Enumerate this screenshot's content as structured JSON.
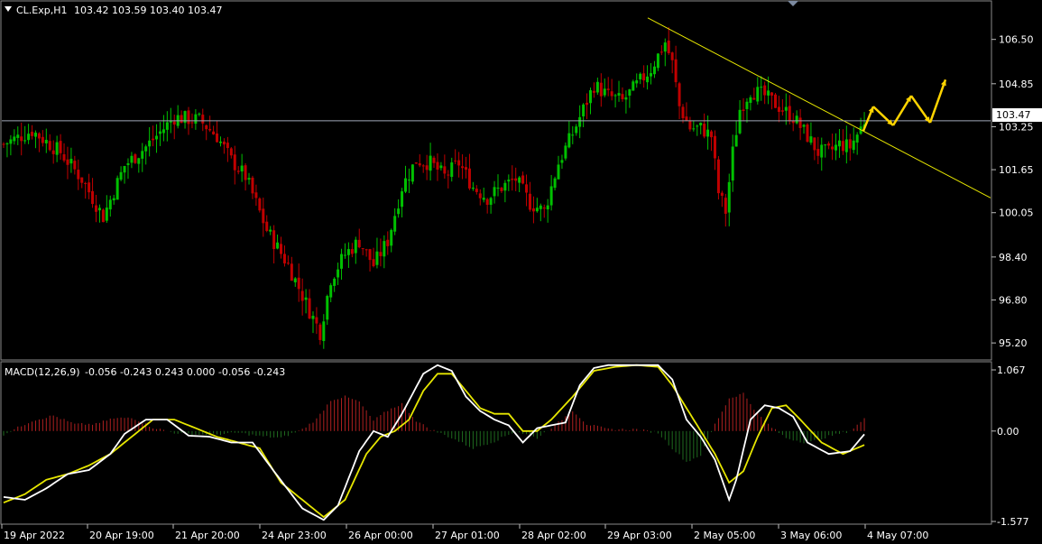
{
  "symbol": "CL.Exp,H1",
  "ohlc": "103.42 103.59 103.40 103.47",
  "macd_label": "MACD(12,26,9)",
  "macd_values": "-0.056 -0.243 0.243 0.000 -0.056 -0.243",
  "current_price": "103.47",
  "colors": {
    "background": "#000000",
    "bull": "#00c000",
    "bear": "#c00000",
    "hist_pos": "#b02020",
    "hist_neg": "#1f6b1f",
    "macd_line": "#ffffff",
    "signal_line": "#e6e600",
    "trendline": "#e6e600",
    "arrows": "#ffd400",
    "price_line": "#9fa8b8",
    "grid_text": "#ffffff"
  },
  "chart_data": [
    {
      "type": "candlestick",
      "title": "CL.Exp,H1",
      "y_ticks": [
        "106.50",
        "104.85",
        "103.25",
        "101.65",
        "100.05",
        "98.40",
        "96.80",
        "95.20"
      ],
      "ylim": [
        94.6,
        107.9
      ],
      "x_ticks": [
        "19 Apr 2022",
        "20 Apr 19:00",
        "21 Apr 20:00",
        "24 Apr 23:00",
        "26 Apr 00:00",
        "27 Apr 01:00",
        "28 Apr 02:00",
        "29 Apr 03:00",
        "2 May 05:00",
        "3 May 06:00",
        "4 May 07:00"
      ],
      "close_path": [
        [
          0,
          102.6
        ],
        [
          8,
          103.1
        ],
        [
          16,
          102.3
        ],
        [
          22,
          101.3
        ],
        [
          28,
          99.9
        ],
        [
          34,
          101.8
        ],
        [
          40,
          102.5
        ],
        [
          48,
          103.6
        ],
        [
          55,
          103.5
        ],
        [
          60,
          102.9
        ],
        [
          64,
          102.0
        ],
        [
          68,
          101.4
        ],
        [
          74,
          99.4
        ],
        [
          80,
          98.1
        ],
        [
          86,
          96.4
        ],
        [
          89,
          95.6
        ],
        [
          92,
          97.6
        ],
        [
          96,
          98.5
        ],
        [
          100,
          99.0
        ],
        [
          104,
          98.1
        ],
        [
          108,
          99.0
        ],
        [
          112,
          101.0
        ],
        [
          116,
          102.0
        ],
        [
          120,
          101.9
        ],
        [
          124,
          101.4
        ],
        [
          128,
          101.9
        ],
        [
          132,
          101.0
        ],
        [
          136,
          100.6
        ],
        [
          140,
          101.0
        ],
        [
          144,
          101.3
        ],
        [
          148,
          100.4
        ],
        [
          152,
          100.1
        ],
        [
          156,
          101.9
        ],
        [
          160,
          103.0
        ],
        [
          163,
          103.9
        ],
        [
          166,
          104.8
        ],
        [
          170,
          104.4
        ],
        [
          174,
          104.2
        ],
        [
          178,
          104.8
        ],
        [
          182,
          105.4
        ],
        [
          186,
          106.4
        ],
        [
          188,
          105.6
        ],
        [
          190,
          104.0
        ],
        [
          193,
          103.2
        ],
        [
          196,
          103.2
        ],
        [
          199,
          102.9
        ],
        [
          201,
          100.8
        ],
        [
          203,
          100.1
        ],
        [
          205,
          102.3
        ],
        [
          207,
          103.9
        ],
        [
          210,
          104.6
        ],
        [
          214,
          104.4
        ],
        [
          218,
          104.0
        ],
        [
          222,
          103.6
        ],
        [
          226,
          102.9
        ],
        [
          229,
          102.3
        ],
        [
          232,
          102.3
        ],
        [
          235,
          102.6
        ],
        [
          238,
          102.5
        ],
        [
          241,
          103.2
        ],
        [
          242,
          103.47
        ]
      ],
      "current_price": 103.47,
      "projection_arrows": [
        [
          103.1,
          104.0
        ],
        [
          104.0,
          103.3
        ],
        [
          103.3,
          104.4
        ],
        [
          104.4,
          103.4
        ],
        [
          103.4,
          105.0
        ]
      ]
    },
    {
      "type": "macd",
      "title": "MACD(12,26,9)",
      "y_ticks": [
        "1.067",
        "0.00",
        "-1.577"
      ],
      "ylim": [
        -1.577,
        1.067
      ],
      "macd_path": [
        [
          0,
          -1.15
        ],
        [
          6,
          -1.2
        ],
        [
          12,
          -1.0
        ],
        [
          18,
          -0.75
        ],
        [
          24,
          -0.68
        ],
        [
          30,
          -0.4
        ],
        [
          34,
          -0.05
        ],
        [
          40,
          0.2
        ],
        [
          46,
          0.2
        ],
        [
          52,
          -0.08
        ],
        [
          58,
          -0.1
        ],
        [
          64,
          -0.2
        ],
        [
          70,
          -0.2
        ],
        [
          76,
          -0.7
        ],
        [
          84,
          -1.35
        ],
        [
          90,
          -1.55
        ],
        [
          94,
          -1.3
        ],
        [
          100,
          -0.35
        ],
        [
          104,
          0.0
        ],
        [
          108,
          -0.1
        ],
        [
          112,
          0.3
        ],
        [
          118,
          1.0
        ],
        [
          122,
          1.15
        ],
        [
          126,
          1.05
        ],
        [
          130,
          0.6
        ],
        [
          134,
          0.35
        ],
        [
          138,
          0.2
        ],
        [
          142,
          0.1
        ],
        [
          146,
          -0.2
        ],
        [
          150,
          0.05
        ],
        [
          154,
          0.1
        ],
        [
          158,
          0.15
        ],
        [
          162,
          0.8
        ],
        [
          166,
          1.1
        ],
        [
          170,
          1.15
        ],
        [
          178,
          1.15
        ],
        [
          184,
          1.15
        ],
        [
          188,
          0.9
        ],
        [
          192,
          0.2
        ],
        [
          196,
          -0.1
        ],
        [
          200,
          -0.5
        ],
        [
          204,
          -1.2
        ],
        [
          206,
          -0.85
        ],
        [
          210,
          0.2
        ],
        [
          214,
          0.45
        ],
        [
          218,
          0.4
        ],
        [
          222,
          0.25
        ],
        [
          226,
          -0.2
        ],
        [
          232,
          -0.4
        ],
        [
          238,
          -0.35
        ],
        [
          242,
          -0.056
        ]
      ],
      "signal_path": [
        [
          0,
          -1.25
        ],
        [
          6,
          -1.1
        ],
        [
          12,
          -0.85
        ],
        [
          18,
          -0.75
        ],
        [
          24,
          -0.6
        ],
        [
          30,
          -0.4
        ],
        [
          36,
          -0.1
        ],
        [
          42,
          0.2
        ],
        [
          48,
          0.2
        ],
        [
          54,
          0.05
        ],
        [
          60,
          -0.1
        ],
        [
          66,
          -0.2
        ],
        [
          72,
          -0.3
        ],
        [
          78,
          -0.9
        ],
        [
          84,
          -1.2
        ],
        [
          90,
          -1.5
        ],
        [
          96,
          -1.2
        ],
        [
          102,
          -0.4
        ],
        [
          106,
          -0.1
        ],
        [
          110,
          0.0
        ],
        [
          114,
          0.2
        ],
        [
          118,
          0.7
        ],
        [
          122,
          1.0
        ],
        [
          126,
          1.0
        ],
        [
          130,
          0.7
        ],
        [
          134,
          0.4
        ],
        [
          138,
          0.3
        ],
        [
          142,
          0.3
        ],
        [
          146,
          0.0
        ],
        [
          150,
          0.0
        ],
        [
          154,
          0.2
        ],
        [
          160,
          0.6
        ],
        [
          166,
          1.05
        ],
        [
          172,
          1.12
        ],
        [
          178,
          1.15
        ],
        [
          184,
          1.12
        ],
        [
          188,
          0.8
        ],
        [
          192,
          0.4
        ],
        [
          196,
          0.0
        ],
        [
          200,
          -0.4
        ],
        [
          204,
          -0.9
        ],
        [
          208,
          -0.7
        ],
        [
          212,
          -0.1
        ],
        [
          216,
          0.4
        ],
        [
          220,
          0.45
        ],
        [
          224,
          0.2
        ],
        [
          230,
          -0.2
        ],
        [
          236,
          -0.4
        ],
        [
          242,
          -0.243
        ]
      ],
      "histogram_path": [
        [
          0,
          -0.1
        ],
        [
          8,
          0.3
        ],
        [
          14,
          0.45
        ],
        [
          20,
          0.2
        ],
        [
          26,
          0.2
        ],
        [
          30,
          0.35
        ],
        [
          36,
          0.4
        ],
        [
          42,
          0.1
        ],
        [
          48,
          -0.05
        ],
        [
          54,
          -0.1
        ],
        [
          60,
          -0.1
        ],
        [
          66,
          -0.05
        ],
        [
          72,
          -0.15
        ],
        [
          78,
          -0.2
        ],
        [
          84,
          0.05
        ],
        [
          88,
          0.35
        ],
        [
          92,
          0.9
        ],
        [
          96,
          1.0
        ],
        [
          100,
          0.85
        ],
        [
          104,
          0.3
        ],
        [
          108,
          0.6
        ],
        [
          112,
          0.8
        ],
        [
          116,
          0.3
        ],
        [
          120,
          0.05
        ],
        [
          126,
          -0.2
        ],
        [
          132,
          -0.5
        ],
        [
          138,
          -0.3
        ],
        [
          144,
          0.0
        ],
        [
          150,
          -0.2
        ],
        [
          156,
          0.25
        ],
        [
          160,
          0.6
        ],
        [
          164,
          0.2
        ],
        [
          170,
          0.05
        ],
        [
          178,
          0.05
        ],
        [
          184,
          -0.05
        ],
        [
          188,
          -0.5
        ],
        [
          192,
          -0.9
        ],
        [
          196,
          -0.7
        ],
        [
          200,
          0.2
        ],
        [
          204,
          0.95
        ],
        [
          208,
          1.1
        ],
        [
          212,
          0.5
        ],
        [
          216,
          0.1
        ],
        [
          220,
          -0.2
        ],
        [
          226,
          -0.35
        ],
        [
          232,
          -0.15
        ],
        [
          238,
          0.0
        ],
        [
          242,
          0.35
        ]
      ]
    }
  ]
}
